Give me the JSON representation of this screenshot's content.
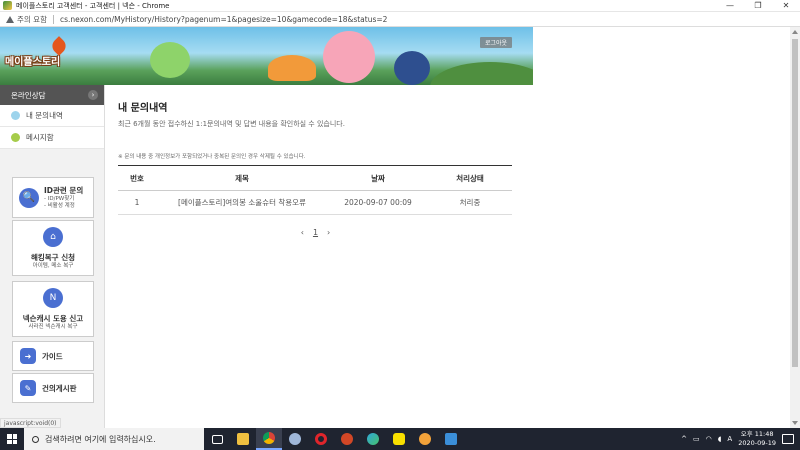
{
  "window": {
    "title": "메이플스토리 고객센터 - 고객센터 | 넥슨 - Chrome",
    "minimize": "—",
    "restore": "❐",
    "close": "✕"
  },
  "address": {
    "warning": "주의 요함",
    "url": "cs.nexon.com/MyHistory/History?pagenum=1&pagesize=10&gamecode=18&status=2"
  },
  "banner": {
    "logo_text": "메이플스토리",
    "logout_label": "로그아웃"
  },
  "sidebar": {
    "header": "온라인상담",
    "header_arrow": "›",
    "links": [
      {
        "label": "내 문의내역",
        "color": "#9ed4ec"
      },
      {
        "label": "메시지함",
        "color": "#a6cc4a"
      }
    ],
    "cards": {
      "id": {
        "title": "ID관련 문의",
        "sub1": "- ID/PW찾기",
        "sub2": "- 비활성 계정",
        "icon": "🔍"
      },
      "hack": {
        "title": "해킹복구 신청",
        "sub": "아이템, 메소 복구",
        "icon": "⌂"
      },
      "cash": {
        "title": "넥슨캐시 도용 신고",
        "sub": "사라진 넥슨캐시 복구",
        "icon": "N"
      },
      "guide": {
        "title": "가이드",
        "icon": "➜"
      },
      "suggest": {
        "title": "건의게시판",
        "icon": "✎"
      }
    }
  },
  "main": {
    "title": "내 문의내역",
    "description": "최근 6개월 동안 접수하신 1:1문의내역 및 답변 내용을 확인하실 수 있습니다.",
    "note": "※ 문의 내용 중 개인정보가 포함되었거나 중복된 문의인 경우 삭제될 수 있습니다.",
    "columns": [
      "번호",
      "제목",
      "날짜",
      "처리상태"
    ],
    "rows": [
      {
        "no": "1",
        "subject": "[메이플스토리]여의봉 소울슈터 착용오류",
        "date": "2020-09-07 00:09",
        "status": "처리중"
      }
    ],
    "pager": {
      "prev": "‹",
      "page": "1",
      "next": "›"
    }
  },
  "status_link": "javascript:void(0)",
  "taskbar": {
    "search_placeholder": "검색하려면 여기에 입력하십시오.",
    "apps": [
      {
        "name": "task-view",
        "color": "#ffffff"
      },
      {
        "name": "file-explorer",
        "color": "#f0c040"
      },
      {
        "name": "chrome",
        "color": "#e8a33a"
      },
      {
        "name": "app-gear",
        "color": "#9fb7d9"
      },
      {
        "name": "opera",
        "color": "#e0252b"
      },
      {
        "name": "powerpoint",
        "color": "#d24726"
      },
      {
        "name": "edge",
        "color": "#2fa8d8"
      },
      {
        "name": "kakaotalk",
        "color": "#f9e000"
      },
      {
        "name": "maple-game",
        "color": "#f2a23a"
      },
      {
        "name": "photos",
        "color": "#3b8fd9"
      }
    ],
    "tray_ime": "A",
    "clock_time": "오후 11:48",
    "clock_date": "2020-09-19"
  }
}
